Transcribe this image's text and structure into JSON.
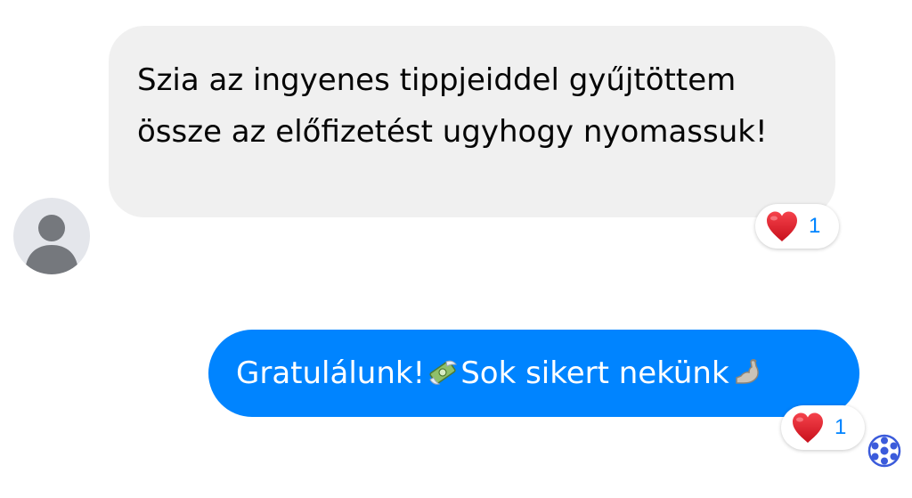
{
  "incoming": {
    "avatar_icon": "person-silhouette-icon",
    "text": "Szia az ingyenes tippjeiddel gyűjtöttem össze az előfizetést ugyhogy nyomassuk!",
    "reaction": {
      "icon": "heart-icon",
      "count": "1"
    }
  },
  "outgoing": {
    "text_part1": "Gratulálunk!",
    "emoji1": "money-with-wings-icon",
    "text_part2": " Sok sikert nekünk",
    "emoji2": "flexed-biceps-icon",
    "reaction": {
      "icon": "heart-icon",
      "count": "1"
    }
  },
  "seen_indicator": {
    "icon": "seen-avatar-icon"
  },
  "colors": {
    "outgoing_bubble": "#0084ff",
    "incoming_bubble": "#f0f0f0",
    "reaction_count": "#0084ff",
    "heart": "#e0262c"
  }
}
